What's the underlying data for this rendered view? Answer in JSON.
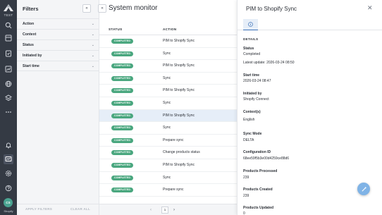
{
  "rail": {
    "logo_text": "TEST",
    "icons": [
      "search-icon",
      "dashboard-icon",
      "list-icon",
      "chart-icon",
      "image-icon",
      "globe-icon",
      "layers-icon",
      "more-icon",
      "bell-icon",
      "monitor-icon",
      "gear-icon",
      "help-icon"
    ],
    "avatar_initials": "CS",
    "avatar_label": "Shopify"
  },
  "filters": {
    "title": "Filters",
    "collapse_icon": "«",
    "items": [
      {
        "label": "Action",
        "chev": "⌄"
      },
      {
        "label": "Context",
        "chev": "⌄"
      },
      {
        "label": "Status",
        "chev": "⌄"
      },
      {
        "label": "Initiated by",
        "chev": "⌄"
      },
      {
        "label": "Start time",
        "chev": "⌄"
      }
    ],
    "apply_label": "APPLY FILTERS",
    "clear_label": "CLEAR ALL"
  },
  "main": {
    "back_icon": "«",
    "title": "System monitor",
    "columns": {
      "status": "STATUS",
      "action": "ACTION"
    },
    "rows": [
      {
        "status": "COMPLETED",
        "action": "PIM to Shopify Sync"
      },
      {
        "status": "COMPLETED",
        "action": "Sync"
      },
      {
        "status": "COMPLETED",
        "action": "PIM to Shopify Sync"
      },
      {
        "status": "COMPLETED",
        "action": "Sync"
      },
      {
        "status": "COMPLETED",
        "action": "PIM to Shopify Sync"
      },
      {
        "status": "COMPLETED",
        "action": "Sync"
      },
      {
        "status": "COMPLETED",
        "action": "PIM to Shopify Sync"
      },
      {
        "status": "COMPLETED",
        "action": "Sync"
      },
      {
        "status": "COMPLETED",
        "action": "Prepare sync"
      },
      {
        "status": "COMPLETED",
        "action": "Change products status"
      },
      {
        "status": "COMPLETED",
        "action": "PIM to Shopify Sync"
      },
      {
        "status": "COMPLETED",
        "action": "Sync"
      },
      {
        "status": "COMPLETED",
        "action": "Prepare sync"
      }
    ],
    "pager": {
      "prev": "‹",
      "page": "1",
      "next": "›"
    }
  },
  "panel": {
    "title": "PIM to Shopify Sync",
    "close_icon": "✕",
    "section": "DETAILS",
    "fields": [
      {
        "label": "Status",
        "values": [
          "Completed",
          "Latest update: 2026-03-24 08:50"
        ]
      },
      {
        "label": "Start time",
        "values": [
          "2026-03-24 08:47"
        ]
      },
      {
        "label": "Initiated by",
        "values": [
          "Shopify Connect"
        ]
      },
      {
        "label": "Context(s)",
        "values": [
          "English"
        ]
      },
      {
        "label": "Sync Mode",
        "values": [
          "DELTA"
        ]
      },
      {
        "label": "Configuration ID",
        "values": [
          "68ee59f5b3e00d4259ce88d6"
        ]
      },
      {
        "label": "Products Processed",
        "values": [
          "239"
        ]
      },
      {
        "label": "Products Created",
        "values": [
          "239"
        ]
      },
      {
        "label": "Products Updated",
        "values": [
          "0"
        ]
      }
    ]
  },
  "colors": {
    "rail_bg": "#343a44",
    "badge_completed": "#4aa77f",
    "selected_row": "#e6eef8",
    "accent": "#3d72b8",
    "fab": "#7fb3e6"
  }
}
